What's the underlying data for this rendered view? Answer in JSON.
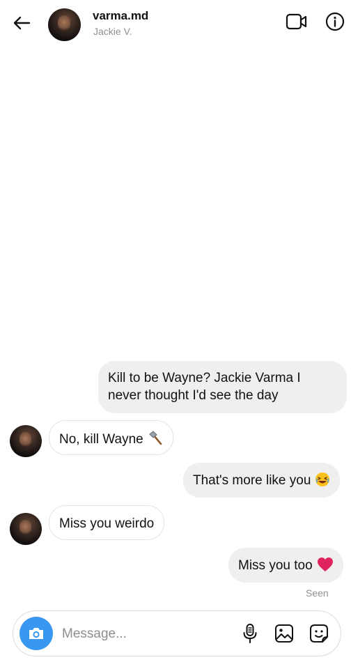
{
  "header": {
    "username": "varma.md",
    "subtitle": "Jackie V.",
    "back_icon": "back-arrow-icon",
    "video_icon": "video-call-icon",
    "info_icon": "info-icon"
  },
  "messages": [
    {
      "from": "me",
      "text_line1": "Kill to be Wayne? Jackie Varma I",
      "text_line2": "never thought I'd see the day"
    },
    {
      "from": "them",
      "text": "No, kill Wayne",
      "emoji": "axe-emoji"
    },
    {
      "from": "me",
      "text": "That's more like you",
      "emoji": "laughing-emoji"
    },
    {
      "from": "them",
      "text": "Miss you weirdo"
    },
    {
      "from": "me",
      "text": "Miss you too",
      "emoji": "red-heart-emoji"
    }
  ],
  "status": {
    "seen": "Seen"
  },
  "composer": {
    "placeholder": "Message...",
    "camera_icon": "camera-icon",
    "mic_icon": "microphone-icon",
    "gallery_icon": "gallery-icon",
    "sticker_icon": "sticker-icon"
  },
  "colors": {
    "accent": "#3897f0",
    "sent_bubble": "#efefef",
    "secondary_text": "#8e8e8e",
    "heart": "#e0245e"
  }
}
